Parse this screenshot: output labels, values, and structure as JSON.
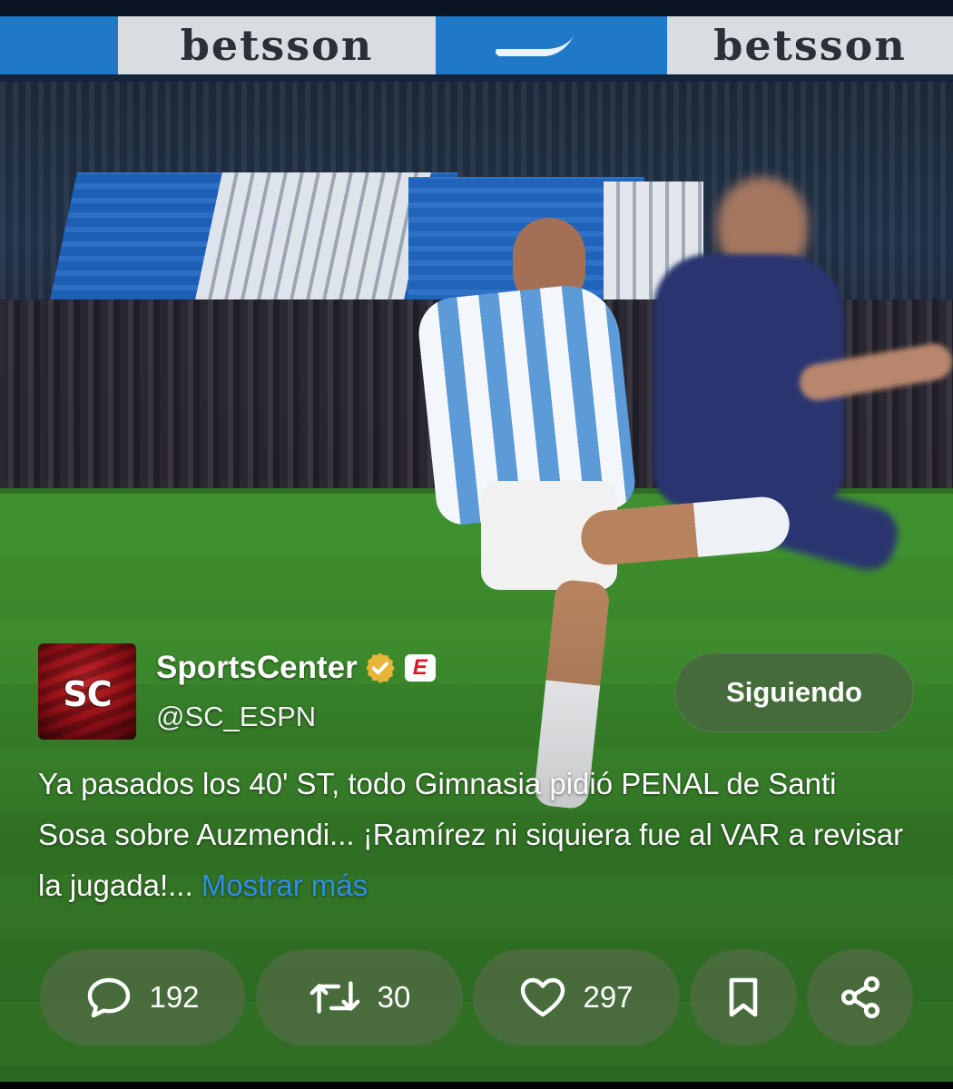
{
  "background": {
    "description_icon": "soccer-match-video",
    "ad_boards": [
      "betsson",
      "betsson"
    ]
  },
  "tweet": {
    "avatar_text": "SC",
    "display_name": "SportsCenter",
    "handle": "@SC_ESPN",
    "affiliate_badge": "E",
    "follow_label": "Siguiendo",
    "text_main": "Ya pasados los 40' ST, todo Gimnasia pidió PENAL de Santi Sosa sobre Auzmendi... ¡Ramírez ni siquiera fue al VAR a revisar la jugada!... ",
    "show_more": "Mostrar más"
  },
  "actions": {
    "replies": "192",
    "retweets": "30",
    "likes": "297"
  },
  "colors": {
    "pill_bg": "#4a6c3e",
    "link": "#2f8ee6",
    "verified_gold": "#e9b43a",
    "espn_red": "#e0172b"
  }
}
